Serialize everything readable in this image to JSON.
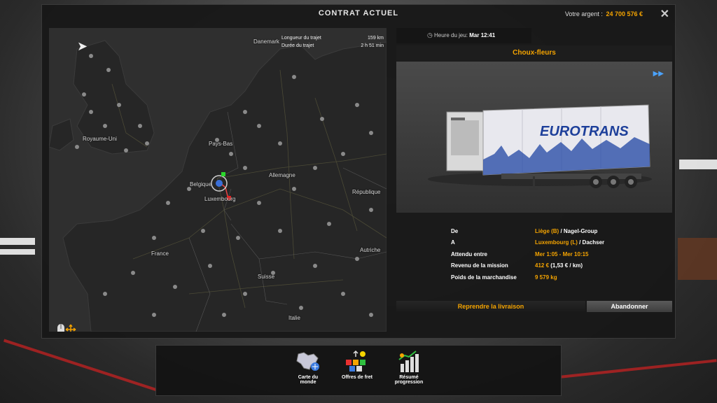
{
  "window": {
    "title": "CONTRAT ACTUEL",
    "money_label": "Votre argent :",
    "money_value": "24 700 576 €",
    "close_glyph": "✕"
  },
  "map": {
    "route_length_label": "Longueur du trajet",
    "route_length_value": "159 km",
    "route_duration_label": "Durée du trajet",
    "route_duration_value": "2 h 51 min",
    "labels": {
      "danemark": "Danemark",
      "royaume_uni": "Royaume-Uni",
      "pays_bas": "Pays-Bas",
      "allemagne": "Allemagne",
      "belgique": "Belgique",
      "luxembourg": "Luxembourg",
      "republique": "République",
      "france": "France",
      "autriche": "Autriche",
      "suisse": "Suisse",
      "italie": "Italie"
    },
    "colors": {
      "land": "#262626",
      "sea": "#2f2f2f",
      "roads": "#5a5a3a",
      "cities": "#8a8a8a"
    }
  },
  "game_time": {
    "label": "Heure du jeu:",
    "value": "Mar 12:41"
  },
  "cargo": {
    "name": "Choux-fleurs",
    "trailer_brand": "EUROTRANS"
  },
  "details": {
    "from_label": "De",
    "from_city": "Liège (B)",
    "from_company": " / Nagel-Group",
    "to_label": "A",
    "to_city": "Luxembourg (L)",
    "to_company": " / Dachser",
    "expected_label": "Attendu entre",
    "expected_value": "Mer 1:05 - Mer 10:15",
    "revenue_label": "Revenu de la mission",
    "revenue_value": "412 €",
    "revenue_rate": " (1,53 € / km)",
    "weight_label": "Poids de la marchandise",
    "weight_value": "9 579 kg"
  },
  "buttons": {
    "resume": "Reprendre la livraison",
    "abandon": "Abandonner"
  },
  "dock": {
    "world_map_line1": "Carte du",
    "world_map_line2": "monde",
    "freight": "Offres de fret",
    "progress_line1": "Résumé",
    "progress_line2": "progression"
  },
  "accent_color": "#f5a400"
}
